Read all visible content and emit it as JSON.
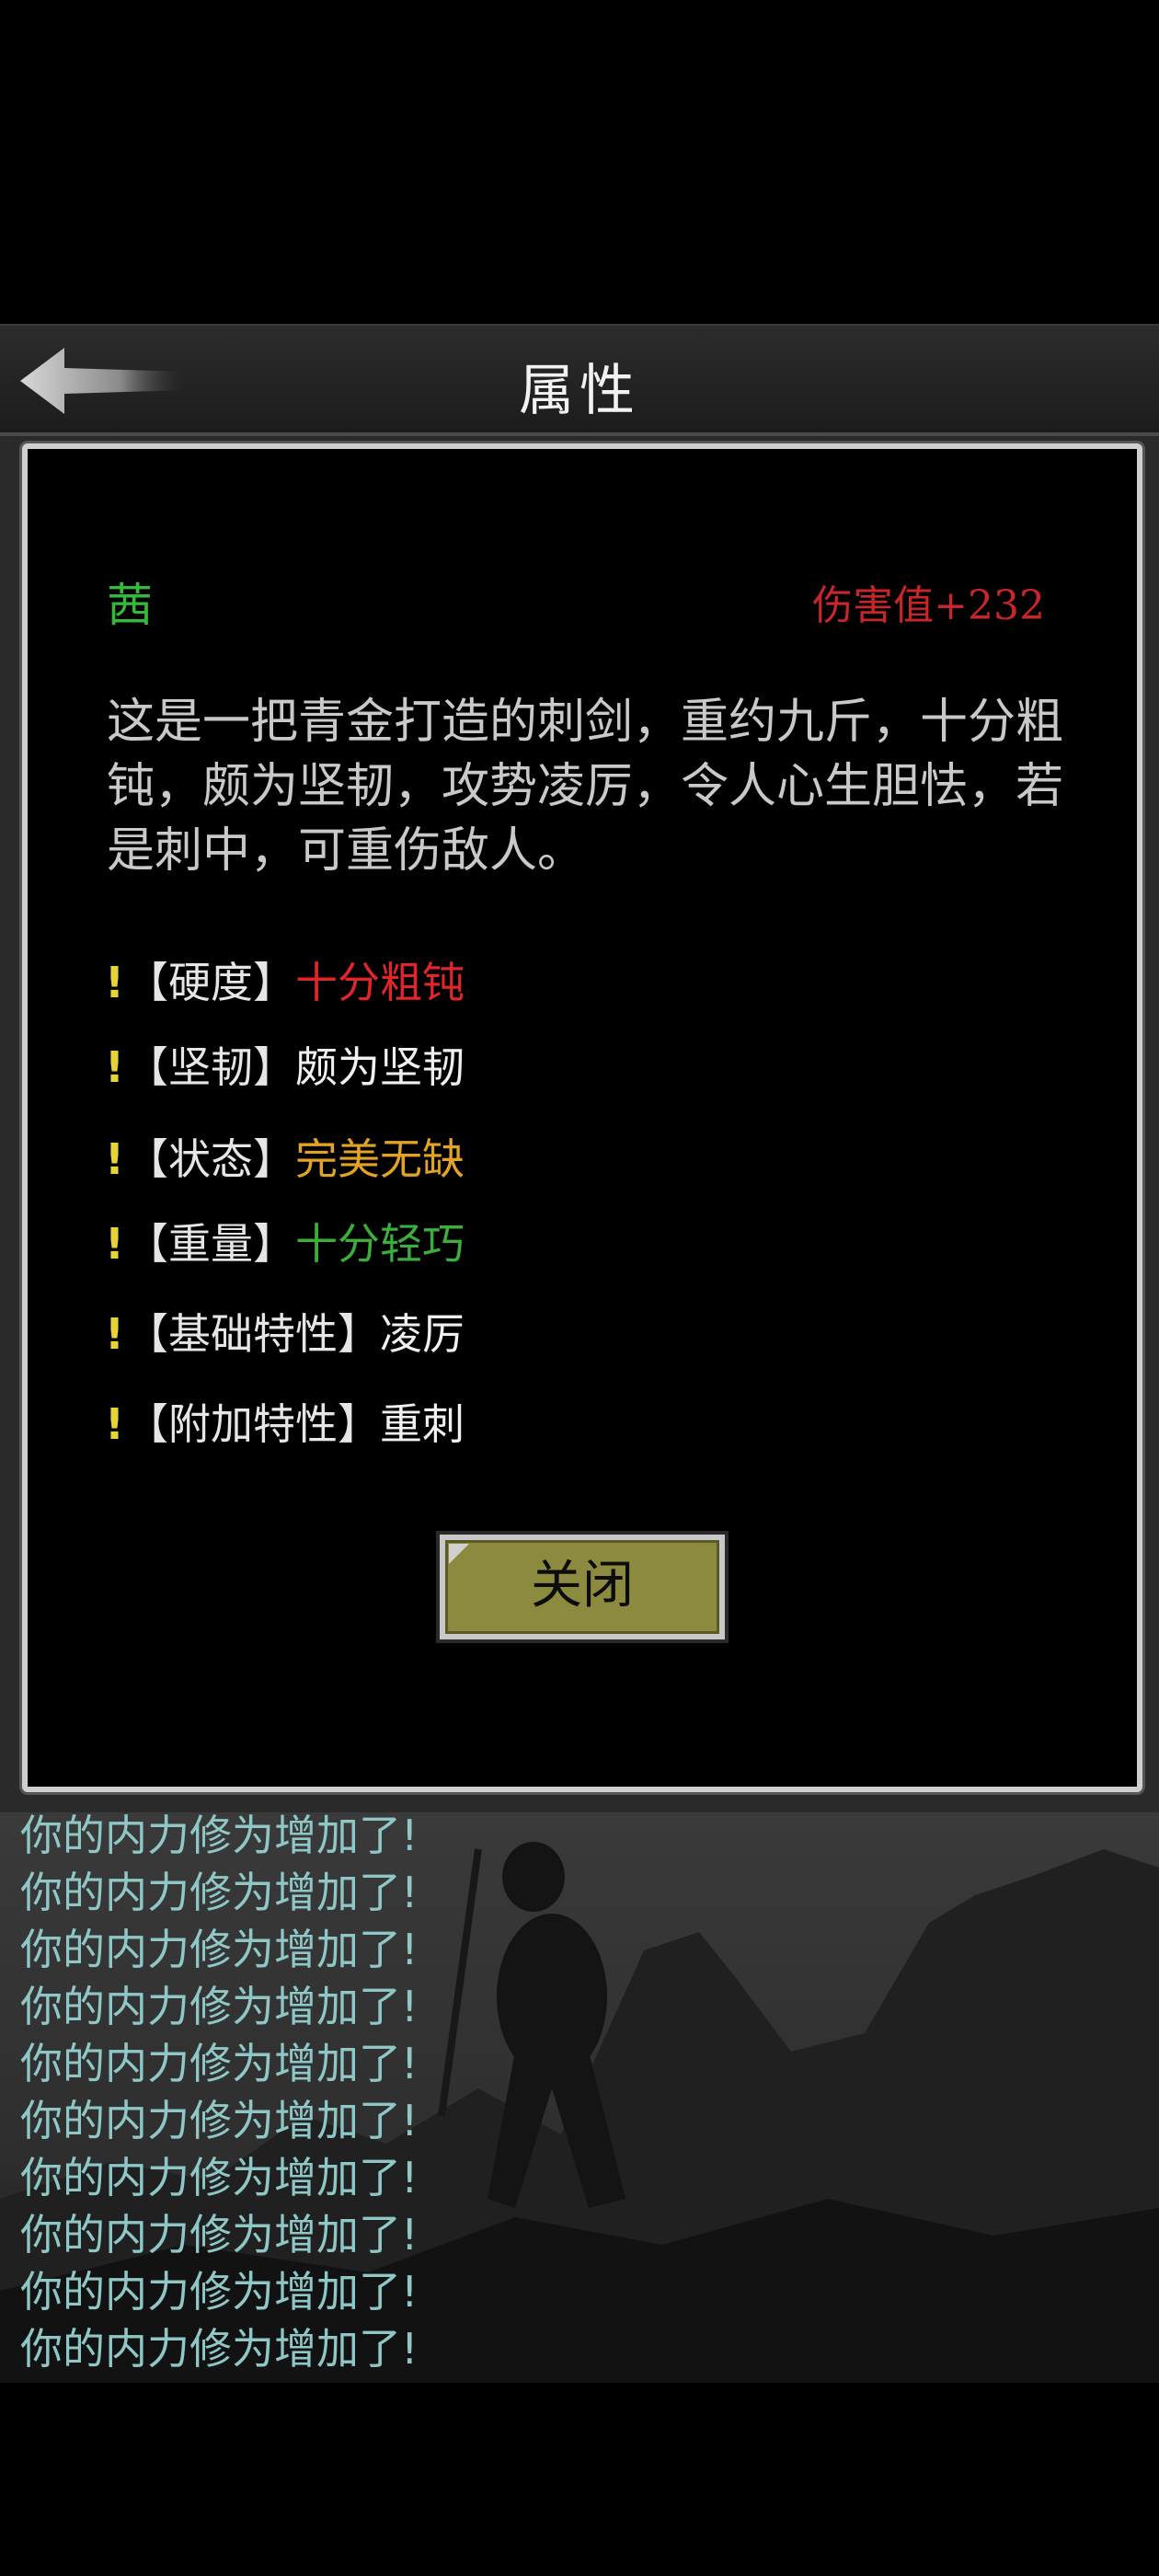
{
  "header": {
    "title": "属性",
    "back_icon": "back-arrow-icon"
  },
  "item": {
    "name": "茜",
    "damage": "伤害值+232",
    "description": "这是一把青金打造的刺剑，重约九斤，十分粗钝，颇为坚韧，攻势凌厉，令人心生胆怯，若是刺中，可重伤敌人。"
  },
  "attributes": [
    {
      "marker": "!",
      "key": "【硬度】",
      "value": "十分粗钝"
    },
    {
      "marker": "!",
      "key": "【坚韧】",
      "value": "颇为坚韧"
    },
    {
      "marker": "!",
      "key": "【状态】",
      "value": "完美无缺"
    },
    {
      "marker": "!",
      "key": "【重量】",
      "value": "十分轻巧"
    },
    {
      "marker": "!",
      "key": "【基础特性】",
      "value": "凌厉"
    },
    {
      "marker": "!",
      "key": "【附加特性】",
      "value": "重刺"
    }
  ],
  "colors": {
    "name": "#36b83a",
    "damage": "#c8262a",
    "red": "#e0262b",
    "orange": "#e3a325",
    "green": "#3cae3c",
    "marker": "#e7d23a",
    "log": "#8fc6c6"
  },
  "close_label": "关闭",
  "log": [
    "你的内力修为增加了!",
    "你的内力修为增加了!",
    "你的内力修为增加了!",
    "你的内力修为增加了!",
    "你的内力修为增加了!",
    "你的内力修为增加了!",
    "你的内力修为增加了!",
    "你的内力修为增加了!",
    "你的内力修为增加了!",
    "你的内力修为增加了!"
  ]
}
